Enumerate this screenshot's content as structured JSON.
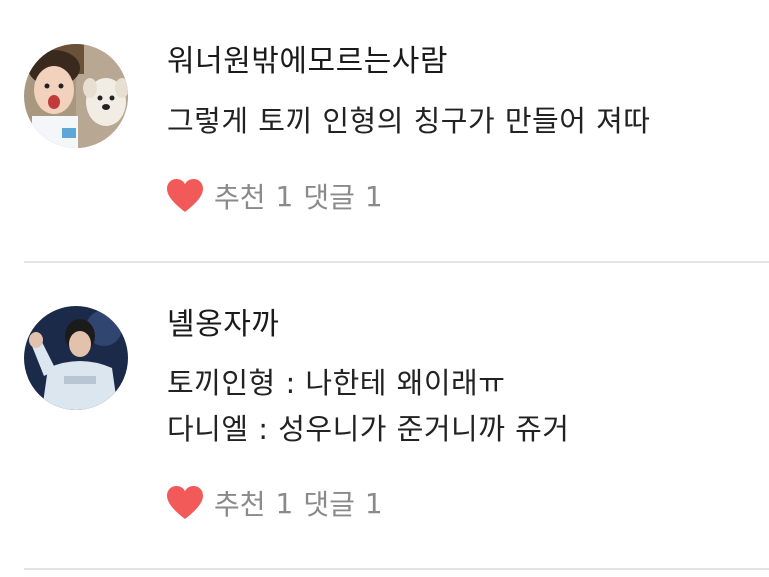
{
  "comments": [
    {
      "username": "워너원밖에모르는사람",
      "avatar": "avatar-boy-with-puppy",
      "lines": [
        "그렇게 토끼 인형의 칭구가 만들어 져따"
      ],
      "like_label": "추천",
      "like_count": "1",
      "reply_label": "댓글",
      "reply_count": "1"
    },
    {
      "username": "녤옹자까",
      "avatar": "avatar-singer-on-stage",
      "lines": [
        "토끼인형 : 나한테  왜이래ㅠ",
        "다니엘 : 성우니가 준거니까 쥬거"
      ],
      "like_label": "추천",
      "like_count": "1",
      "reply_label": "댓글",
      "reply_count": "1"
    }
  ],
  "colors": {
    "heart": "#f25a5a",
    "action_text": "#8a8a8a",
    "divider": "#e3e3e3",
    "text": "#222222"
  },
  "icons": {
    "like": "heart-icon"
  }
}
